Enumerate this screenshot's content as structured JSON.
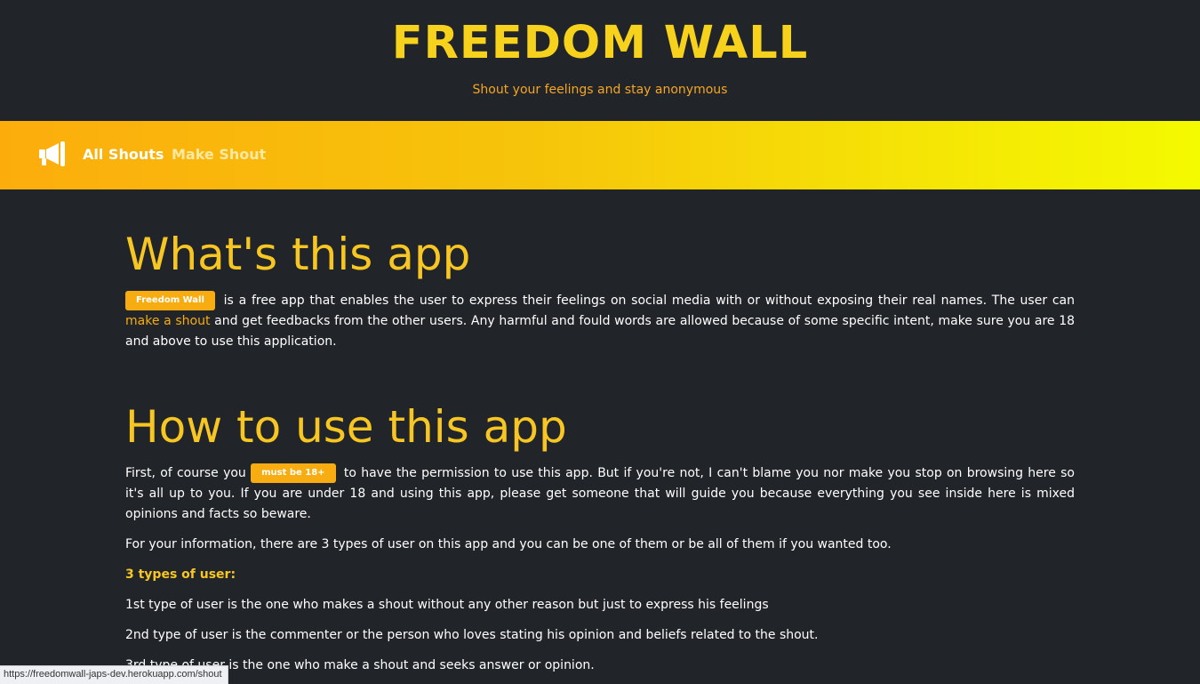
{
  "header": {
    "title": "FREEDOM WALL",
    "tagline": "Shout your feelings and stay anonymous"
  },
  "nav": {
    "logo_icon": "megaphone-icon",
    "links": [
      {
        "label": "All Shouts"
      },
      {
        "label": "Make Shout"
      }
    ]
  },
  "about": {
    "heading": "What's this app",
    "badge": "Freedom Wall",
    "text_before_link": "is a free app that enables the user to express their feelings on social media with or without exposing their real names. The user can",
    "link": "make a shout",
    "text_after_link": "and get feedbacks from the other users. Any harmful and fould words are allowed because of some specific intent, make sure you are 18 and above to use this application."
  },
  "howto": {
    "heading": "How to use this app",
    "first_before": "First, of course you",
    "badge": "must be 18+",
    "first_after": "to have the permission to use this app. But if you're not, I can't blame you nor make you stop on browsing here so it's all up to you. If you are under 18 and using this app, please get someone that will guide you because everything you see inside here is mixed opinions and facts so beware.",
    "info": "For your information, there are 3 types of user on this app and you can be one of them or be all of them if you wanted too.",
    "types_heading": "3 types of user:",
    "types": [
      "1st type of user is the one who makes a shout without any other reason but just to express his feelings",
      "2nd type of user is the commenter or the person who loves stating his opinion and beliefs related to the shout.",
      "3rd type of user is the one who make a shout and seeks answer or opinion."
    ]
  },
  "statusbar": {
    "url": "https://freedomwall-japs-dev.herokuapp.com/shout"
  },
  "colors": {
    "background": "#212428",
    "accent": "#f7c623",
    "badge": "#f7ad12",
    "nav_gradient_start": "#fcad0c",
    "nav_gradient_end": "#f4fa00"
  }
}
